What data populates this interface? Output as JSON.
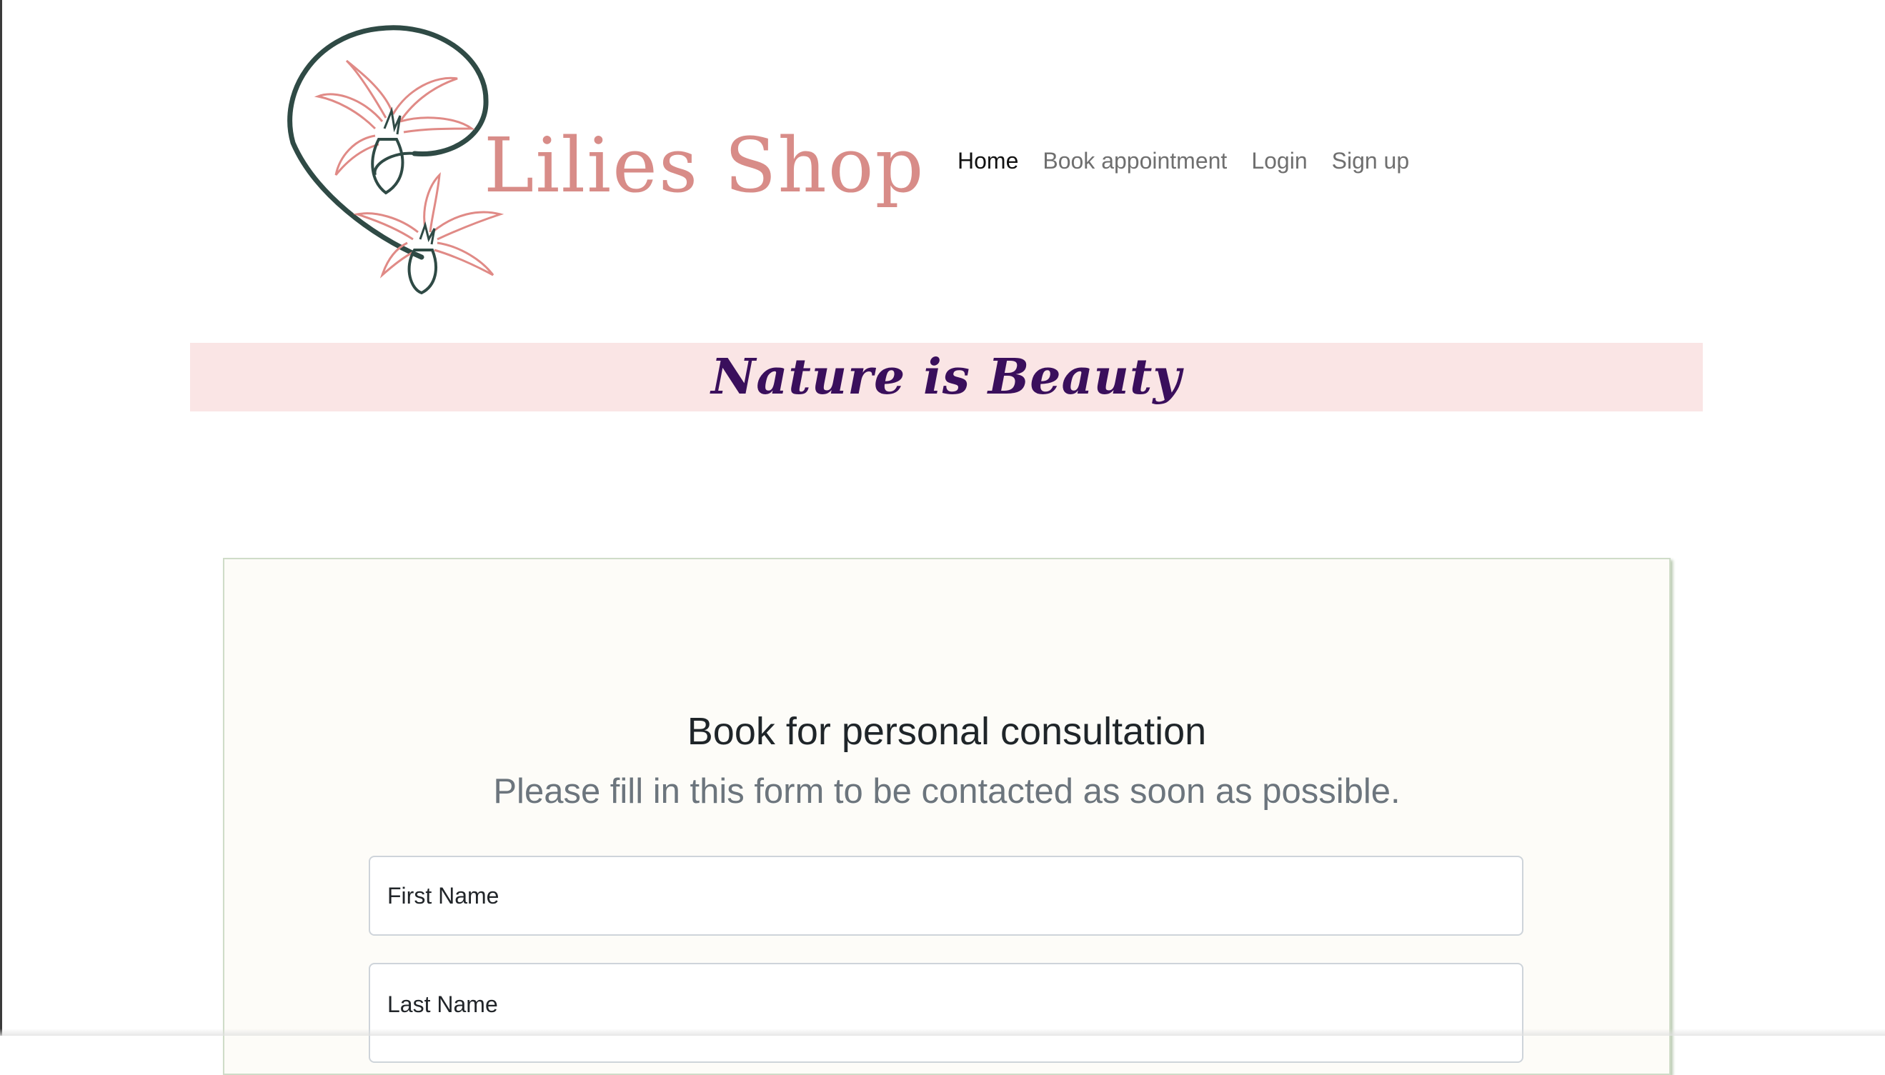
{
  "brand": {
    "name": "Lilies Shop",
    "logo_icon": "lily-flower-icon",
    "colors": {
      "logo_text": "#d4807c",
      "logo_stroke": "#2f4a45",
      "petal": "#e08a86"
    }
  },
  "nav": {
    "items": [
      {
        "label": "Home",
        "active": true
      },
      {
        "label": "Book appointment",
        "active": false
      },
      {
        "label": "Login",
        "active": false
      },
      {
        "label": "Sign up",
        "active": false
      }
    ]
  },
  "banner": {
    "text": "Nature is Beauty",
    "colors": {
      "background": "#fae5e5",
      "text": "#3a0f5c"
    }
  },
  "form": {
    "title": "Book for personal consultation",
    "subtitle": "Please fill in this form to be contacted as soon as possible.",
    "fields": [
      {
        "placeholder": "First Name",
        "value": ""
      },
      {
        "placeholder": "Last Name",
        "value": ""
      }
    ],
    "colors": {
      "card_background": "#fdfcf8",
      "card_border": "#cfdcc8"
    }
  }
}
